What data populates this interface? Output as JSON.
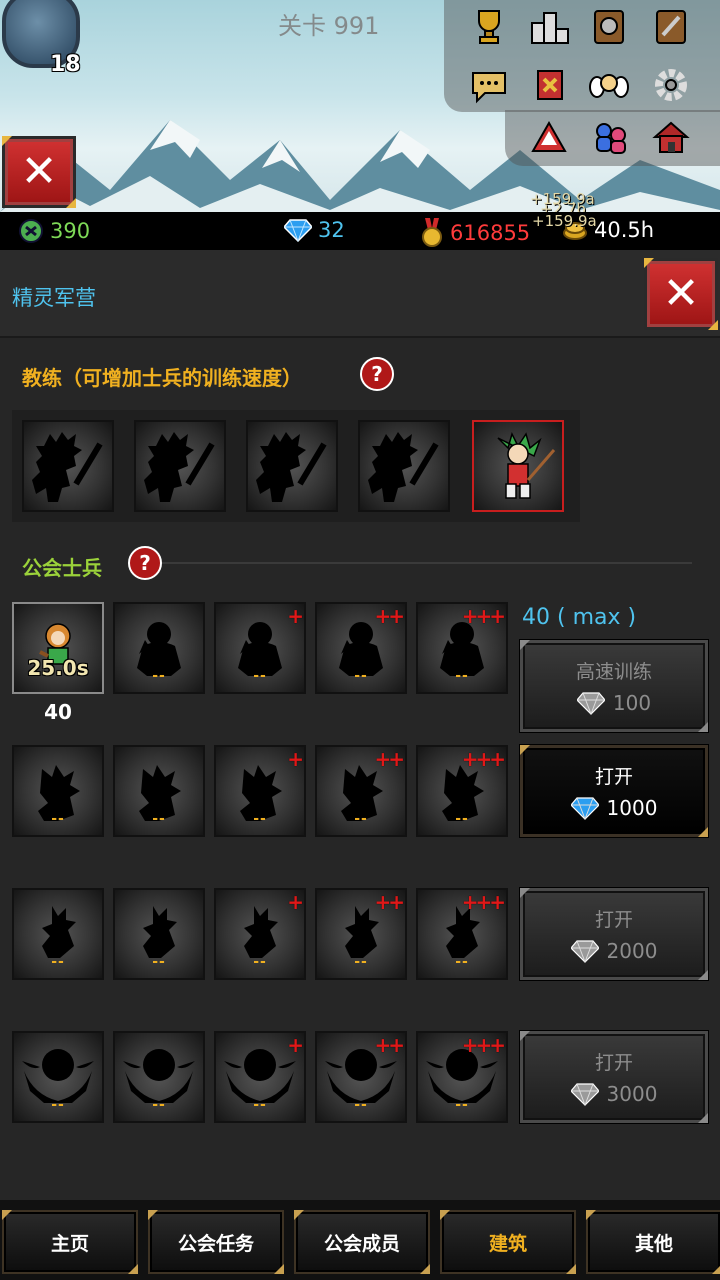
{
  "hud": {
    "stage": "关卡 991",
    "player_level": "18",
    "floating": [
      "+159.9a",
      "+2.7b",
      "+159.9a"
    ]
  },
  "resources": {
    "skulls": "390",
    "gems": "32",
    "medals": "616855",
    "time": "40.5h"
  },
  "panel": {
    "title": "精灵军营",
    "coach_section": "教练（可增加士兵的训练速度）",
    "coach_help": "?",
    "guild_section": "公会士兵",
    "guild_help": "?",
    "troop_count": "40 ( max )",
    "first_slot_timer": "25.0s",
    "first_slot_count": "40",
    "slot_placeholder": "--",
    "plus_marks": [
      "",
      "",
      "+",
      "++",
      "+++"
    ]
  },
  "buttons": [
    {
      "label": "高速训练",
      "cost": "100",
      "enabled": false
    },
    {
      "label": "打开",
      "cost": "1000",
      "enabled": true
    },
    {
      "label": "打开",
      "cost": "2000",
      "enabled": false
    },
    {
      "label": "打开",
      "cost": "3000",
      "enabled": false
    }
  ],
  "nav": {
    "items": [
      "主页",
      "公会任务",
      "公会成员",
      "建筑",
      "其他"
    ],
    "current": "建筑"
  },
  "colors": {
    "accent_blue": "#4fc3ee",
    "section_orange": "#f0b020",
    "section_green": "#9bd23a",
    "medal_red": "#ff3b3b",
    "close_red": "#c62828"
  }
}
